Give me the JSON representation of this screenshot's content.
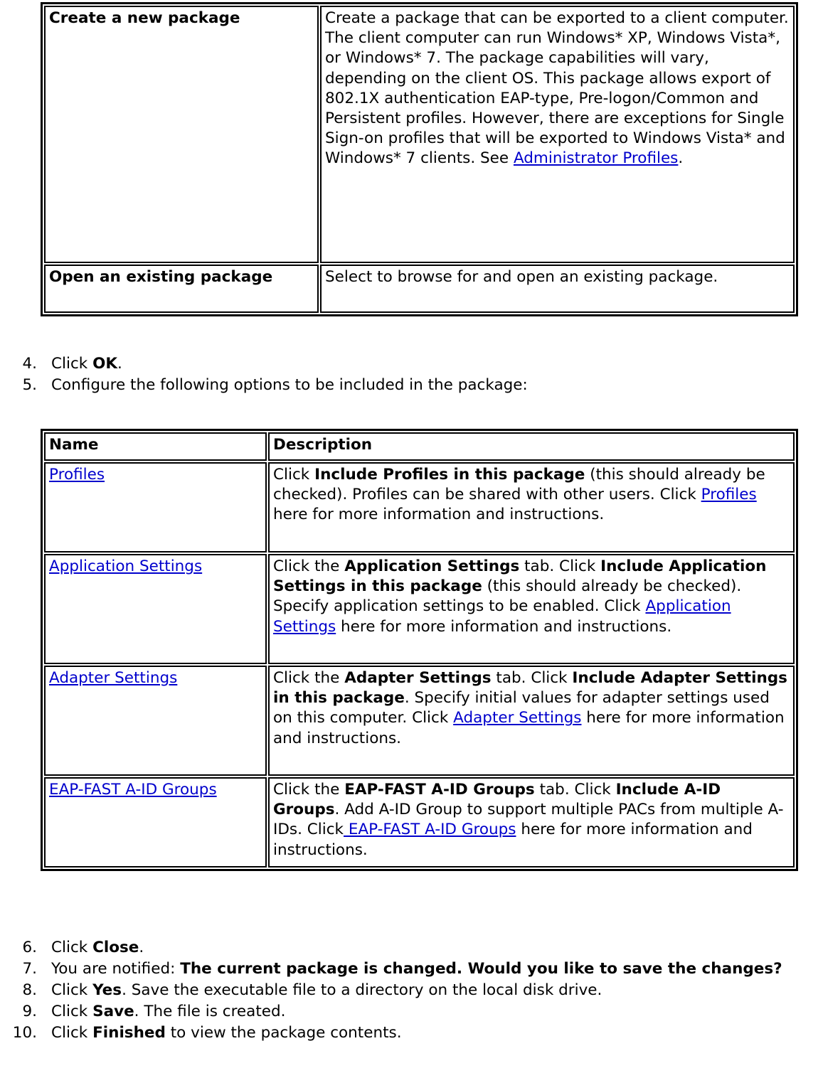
{
  "tables": {
    "create_open": {
      "rows": [
        {
          "name": "Create a new package",
          "description_parts": [
            {
              "type": "text",
              "text": "Create a package that can be exported to a client computer. The client computer can run Windows* XP, Windows Vista*, or Windows* 7. The package capabilities will vary, depending on the client OS. This package allows export of 802.1X authentication EAP-type, Pre-logon/Common and Persistent profiles. However, there are exceptions for Single Sign-on profiles that will be exported to Windows Vista* and Windows* 7 clients. See "
            },
            {
              "type": "link",
              "text": "Administrator Profiles"
            },
            {
              "type": "text",
              "text": "."
            }
          ]
        },
        {
          "name": "Open an existing package",
          "description_parts": [
            {
              "type": "text",
              "text": "Select to browse for and open an existing package."
            }
          ]
        }
      ]
    },
    "package_options": {
      "headers": {
        "name": "Name",
        "description": "Description"
      },
      "rows": [
        {
          "name_link": "Profiles",
          "description_parts": [
            {
              "type": "text",
              "text": "Click "
            },
            {
              "type": "bold",
              "text": "Include Profiles in this package"
            },
            {
              "type": "text",
              "text": " (this should already be checked). Profiles can be shared with other users. Click "
            },
            {
              "type": "link",
              "text": "Profiles"
            },
            {
              "type": "text",
              "text": " here for more information and instructions."
            }
          ]
        },
        {
          "name_link": "Application Settings",
          "description_parts": [
            {
              "type": "text",
              "text": "Click the "
            },
            {
              "type": "bold",
              "text": "Application Settings"
            },
            {
              "type": "text",
              "text": " tab. Click "
            },
            {
              "type": "bold",
              "text": "Include Application Settings in this package"
            },
            {
              "type": "text",
              "text": " (this should already be checked). Specify application settings to be enabled. Click "
            },
            {
              "type": "link",
              "text": "Application Settings"
            },
            {
              "type": "text",
              "text": " here for more information and instructions."
            }
          ]
        },
        {
          "name_link": "Adapter Settings",
          "description_parts": [
            {
              "type": "text",
              "text": "Click the "
            },
            {
              "type": "bold",
              "text": "Adapter Settings"
            },
            {
              "type": "text",
              "text": " tab. Click "
            },
            {
              "type": "bold",
              "text": "Include Adapter Settings in this package"
            },
            {
              "type": "text",
              "text": ". Specify initial values for adapter settings used on this computer. Click "
            },
            {
              "type": "link",
              "text": "Adapter Settings"
            },
            {
              "type": "text",
              "text": " here for more information and instructions."
            }
          ]
        },
        {
          "name_link": "EAP-FAST A-ID Groups",
          "description_parts": [
            {
              "type": "text",
              "text": "Click the "
            },
            {
              "type": "bold",
              "text": "EAP-FAST A-ID Groups"
            },
            {
              "type": "text",
              "text": " tab. Click "
            },
            {
              "type": "bold",
              "text": "Include A-ID Groups"
            },
            {
              "type": "text",
              "text": ". Add A-ID Group to support multiple PACs from multiple A-IDs. Click"
            },
            {
              "type": "link",
              "text": " EAP-FAST A-ID Groups"
            },
            {
              "type": "text",
              "text": " here for more information and instructions."
            }
          ]
        }
      ]
    }
  },
  "steps_mid": [
    {
      "num": "4.",
      "parts": [
        {
          "type": "text",
          "text": "Click "
        },
        {
          "type": "bold",
          "text": "OK"
        },
        {
          "type": "text",
          "text": "."
        }
      ]
    },
    {
      "num": "5.",
      "parts": [
        {
          "type": "text",
          "text": "Configure the following options to be included in the package:"
        }
      ]
    }
  ],
  "steps_end": [
    {
      "num": "6.",
      "parts": [
        {
          "type": "text",
          "text": "Click "
        },
        {
          "type": "bold",
          "text": "Close"
        },
        {
          "type": "text",
          "text": "."
        }
      ]
    },
    {
      "num": "7.",
      "parts": [
        {
          "type": "text",
          "text": "You are notified: "
        },
        {
          "type": "bold",
          "text": "The current package is changed. Would you like to save the changes?"
        }
      ]
    },
    {
      "num": "8.",
      "parts": [
        {
          "type": "text",
          "text": "Click "
        },
        {
          "type": "bold",
          "text": "Yes"
        },
        {
          "type": "text",
          "text": ". Save the executable file to a directory on the local disk drive."
        }
      ]
    },
    {
      "num": "9.",
      "parts": [
        {
          "type": "text",
          "text": "Click "
        },
        {
          "type": "bold",
          "text": "Save"
        },
        {
          "type": "text",
          "text": ". The file is created."
        }
      ]
    },
    {
      "num": "10.",
      "parts": [
        {
          "type": "text",
          "text": "Click "
        },
        {
          "type": "bold",
          "text": "Finished"
        },
        {
          "type": "text",
          "text": " to view the package contents."
        }
      ]
    }
  ],
  "colors": {
    "link": "#0000cc",
    "text": "#000000",
    "border": "#000000",
    "background": "#ffffff"
  }
}
